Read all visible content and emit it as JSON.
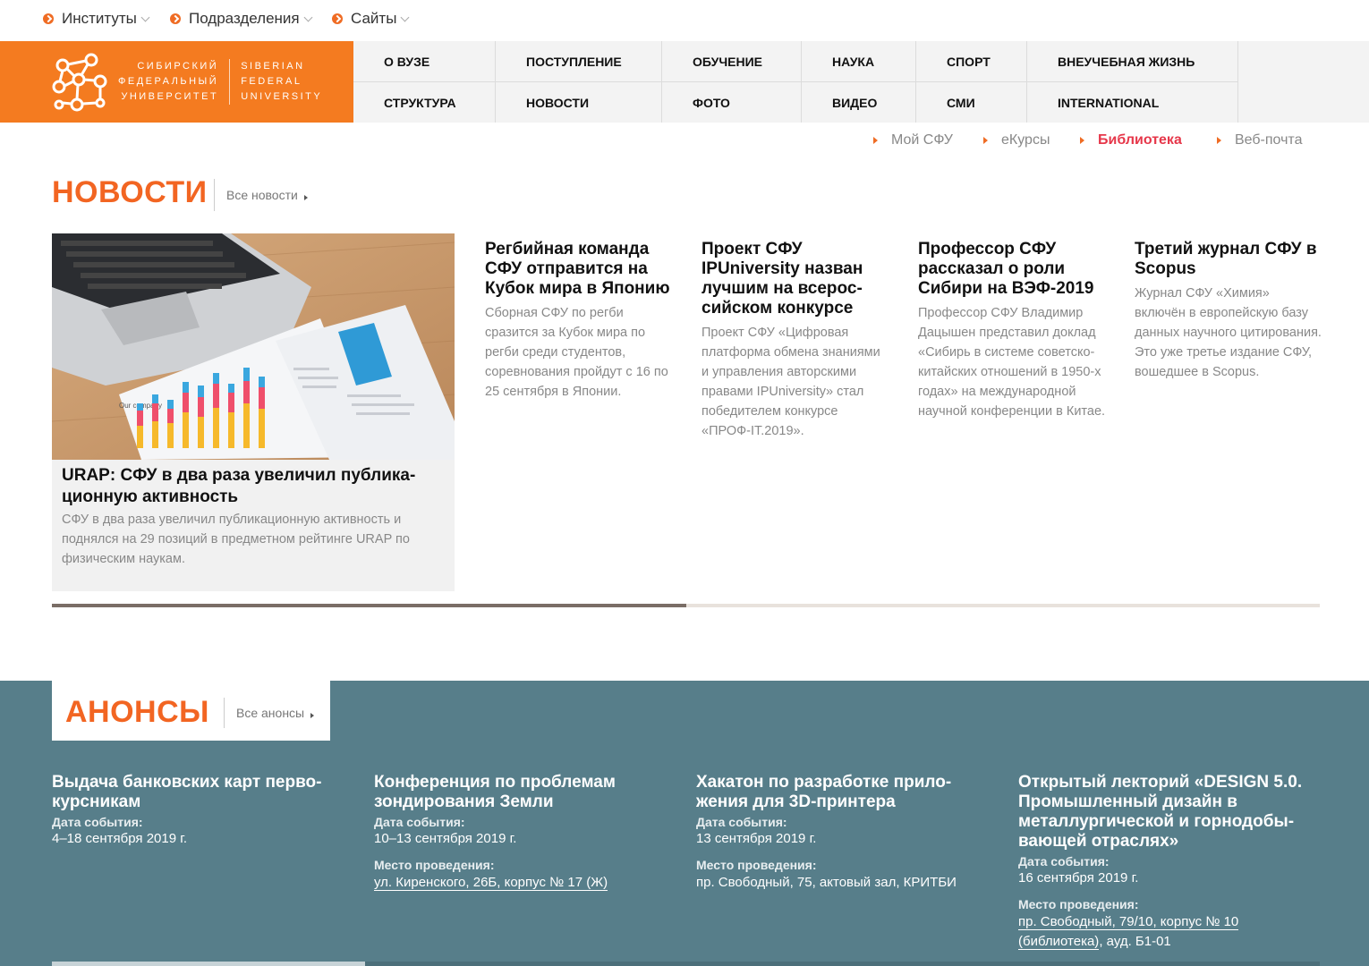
{
  "topbar": {
    "items": [
      {
        "label": "Институты"
      },
      {
        "label": "Подразделения"
      },
      {
        "label": "Сайты"
      }
    ]
  },
  "logo": {
    "ru_line1": "СИБИРСКИЙ",
    "ru_line2": "ФЕДЕРАЛЬНЫЙ",
    "ru_line3": "УНИВЕРСИТЕТ",
    "en_line1": "SIBERIAN",
    "en_line2": "FEDERAL",
    "en_line3": "UNIVERSITY"
  },
  "nav": {
    "row1": [
      "О ВУЗЕ",
      "ПОСТУПЛЕНИЕ",
      "ОБУЧЕНИЕ",
      "НАУКА",
      "СПОРТ",
      "ВНЕУЧЕБНАЯ ЖИЗНЬ"
    ],
    "row2": [
      "СТРУКТУРА",
      "НОВОСТИ",
      "ФОТО",
      "ВИДЕО",
      "СМИ",
      "INTERNATIONAL"
    ]
  },
  "quick_links": [
    "Мой СФУ",
    "еКурсы",
    "Библиотека",
    "Веб-почта"
  ],
  "news": {
    "heading": "НОВОСТИ",
    "all_link": "Все новости",
    "featured": {
      "title": "URAP: СФУ в два раза увеличил публика­ционную активность",
      "text": "СФУ в два раза увеличил публикационную активность и поднялся на 29 позиций в предметном рейтинге URAP по физическим наукам.",
      "image_caption": "Our company"
    },
    "items": [
      {
        "title": "Регбийная команда СФУ отправится на Кубок мира в Японию",
        "text": "Сборная СФУ по регби сразится за Кубок мира по регби среди студентов, соревнования пройдут с 16 по 25 сентября в Японии."
      },
      {
        "title": "Проект СФУ IPUniversity назван лучшим на всерос­сийском конкурсе",
        "text": "Проект СФУ «Цифровая платформа обмена знаниями и управления авторскими правами IPUniversity» стал победителем конкурсе «ПРОФ-IT.2019»."
      },
      {
        "title": "Профессор СФУ рассказал о роли Сибири на ВЭФ-2019",
        "text": "Профессор СФУ Владимир Дацышен представил доклад «Сибирь в системе советско-китайских отношений в 1950-х годах» на международной научной конференции в Китае."
      },
      {
        "title": "Третий журнал СФУ в Scopus",
        "text": "Журнал СФУ «Химия» включён в европейскую базу данных научного цитирования. Это уже третье издание СФУ, вошедшее в Scopus."
      }
    ],
    "scroll_progress": 0.5
  },
  "anons": {
    "heading": "АНОНСЫ",
    "all_link": "Все анонсы",
    "date_label": "Дата события:",
    "place_label": "Место проведения:",
    "items": [
      {
        "title": "Выдача банковских карт перво­курсникам",
        "date": "4–18 сентября 2019 г.",
        "place": "",
        "place_extra": ""
      },
      {
        "title": "Конференция по проблемам зондирования Земли",
        "date": "10–13 сентября 2019 г.",
        "place": "ул. Киренского, 26Б, корпус № 17 (Ж)",
        "place_extra": ""
      },
      {
        "title": "Хакатон по разработке прило­жения для 3D-принтера",
        "date": "13 сентября 2019 г.",
        "place": "пр. Свободный, 75, актовый зал, КРИТБИ",
        "place_extra": ""
      },
      {
        "title": "Открытый лекторий «DESIGN 5.0. Промышленный дизайн в металлургической и горнодобы­вающей отраслях»",
        "date": "16 сентября 2019 г.",
        "place": "пр. Свободный, 79/10, корпус № 10 (библиотека)",
        "place_extra": ", ауд. Б1-01"
      }
    ]
  },
  "colors": {
    "brand_orange": "#f47b20",
    "heading_orange": "#f26522",
    "active_link": "#e6374a",
    "anons_bg": "#577e8a"
  }
}
